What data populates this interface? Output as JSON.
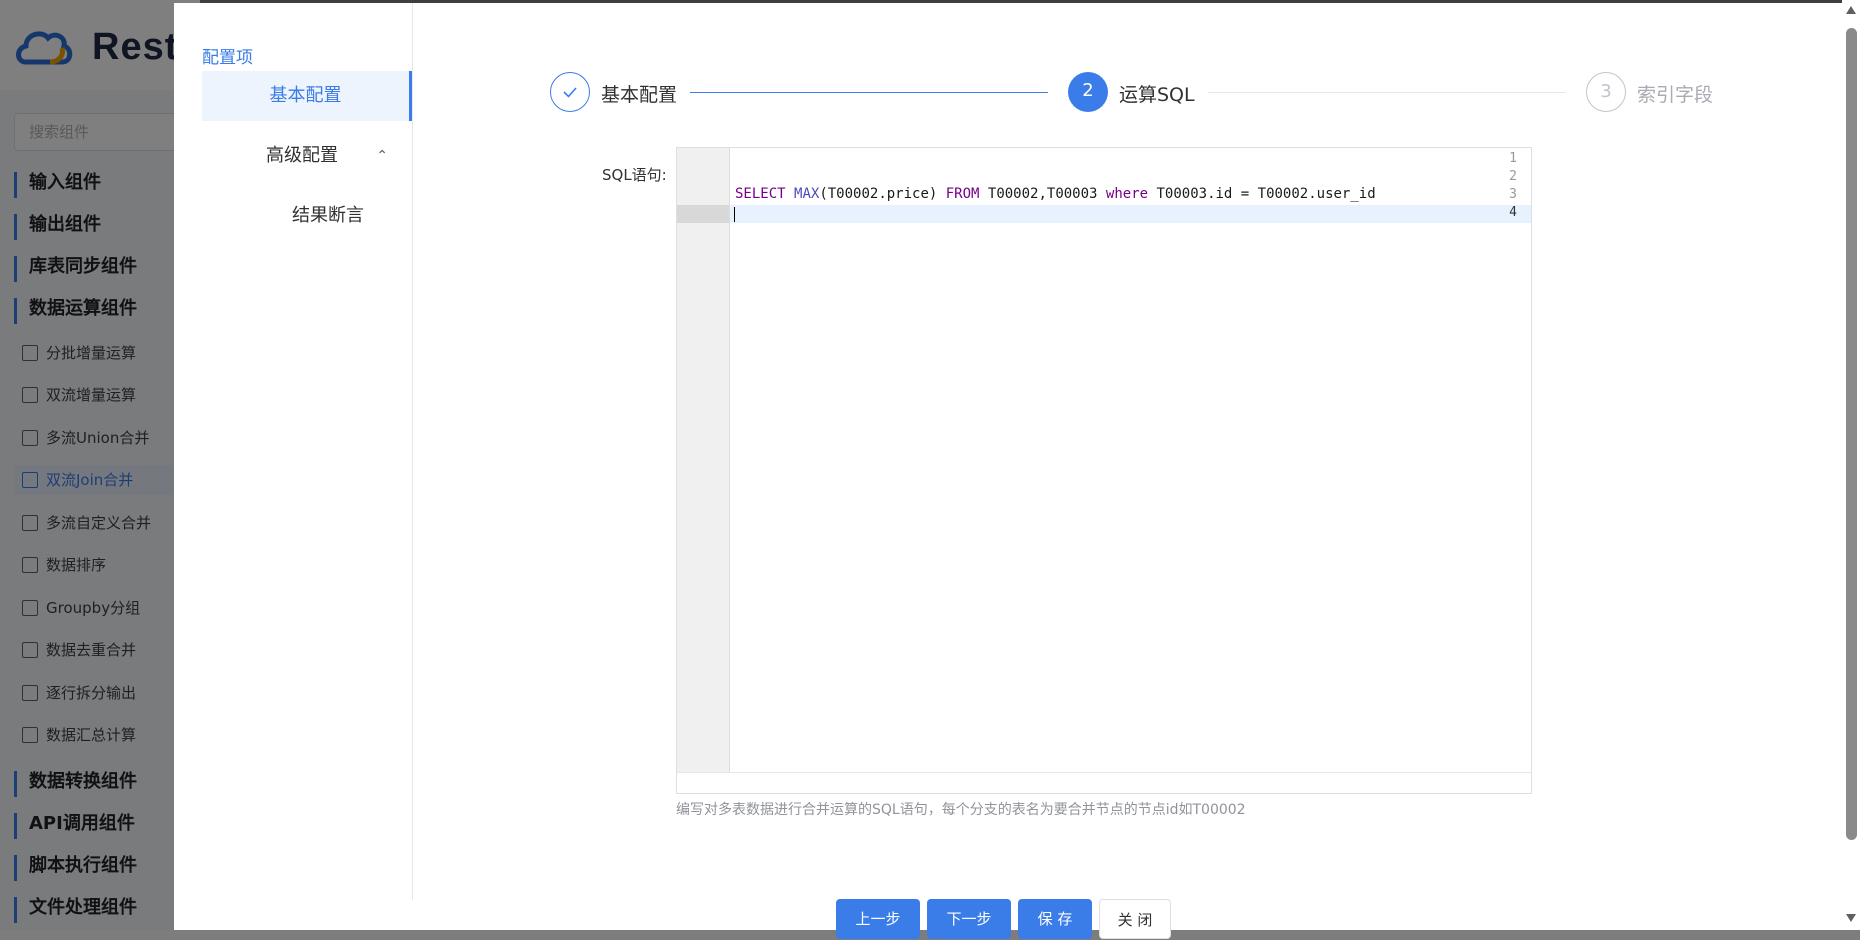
{
  "background": {
    "logo_text": "Rest",
    "search_placeholder": "搜索组件",
    "groups": [
      "输入组件",
      "输出组件",
      "库表同步组件",
      "数据运算组件"
    ],
    "items": [
      {
        "label": "分批增量运算",
        "icon": "batch-icon"
      },
      {
        "label": "双流增量运算",
        "icon": "dual-stream-icon"
      },
      {
        "label": "多流Union合并",
        "icon": "union-icon"
      },
      {
        "label": "双流Join合并",
        "icon": "join-icon",
        "active": true
      },
      {
        "label": "多流自定义合并",
        "icon": "custom-merge-icon"
      },
      {
        "label": "数据排序",
        "icon": "sort-icon"
      },
      {
        "label": "Groupby分组",
        "icon": "groupby-icon"
      },
      {
        "label": "数据去重合并",
        "icon": "dedupe-icon"
      },
      {
        "label": "逐行拆分输出",
        "icon": "split-icon"
      },
      {
        "label": "数据汇总计算",
        "icon": "summary-icon"
      }
    ],
    "groups_bottom": [
      "数据转换组件",
      "API调用组件",
      "脚本执行组件",
      "文件处理组件"
    ]
  },
  "sidebar": {
    "title": "配置项",
    "items": [
      {
        "label": "基本配置",
        "active": true
      },
      {
        "label": "高级配置",
        "expandable": true
      },
      {
        "label": "结果断言",
        "sub": true
      }
    ]
  },
  "steps": [
    {
      "index": "1",
      "label": "基本配置",
      "status": "done"
    },
    {
      "index": "2",
      "label": "运算SQL",
      "status": "active"
    },
    {
      "index": "3",
      "label": "索引字段",
      "status": "pending"
    }
  ],
  "form": {
    "sql_label": "SQL语句:",
    "hint": "编写对多表数据进行合并运算的SQL语句，每个分支的表名为要合并节点的节点id如T00002"
  },
  "editor": {
    "line_numbers": [
      "1",
      "2",
      "3",
      "4"
    ],
    "current_line": 4,
    "code": {
      "kw_select": "SELECT",
      "fn_max": "MAX",
      "arg": "(T00002.price) ",
      "kw_from": "FROM",
      "tables": " T00002,T00003 ",
      "kw_where": "where",
      "cond": " T00003.id = T00002.user_id"
    }
  },
  "buttons": {
    "prev": "上一步",
    "next": "下一步",
    "save": "保 存",
    "close": "关 闭"
  },
  "colors": {
    "accent": "#3a7ce8",
    "keyword": "#770088",
    "function": "#4a4abd"
  }
}
